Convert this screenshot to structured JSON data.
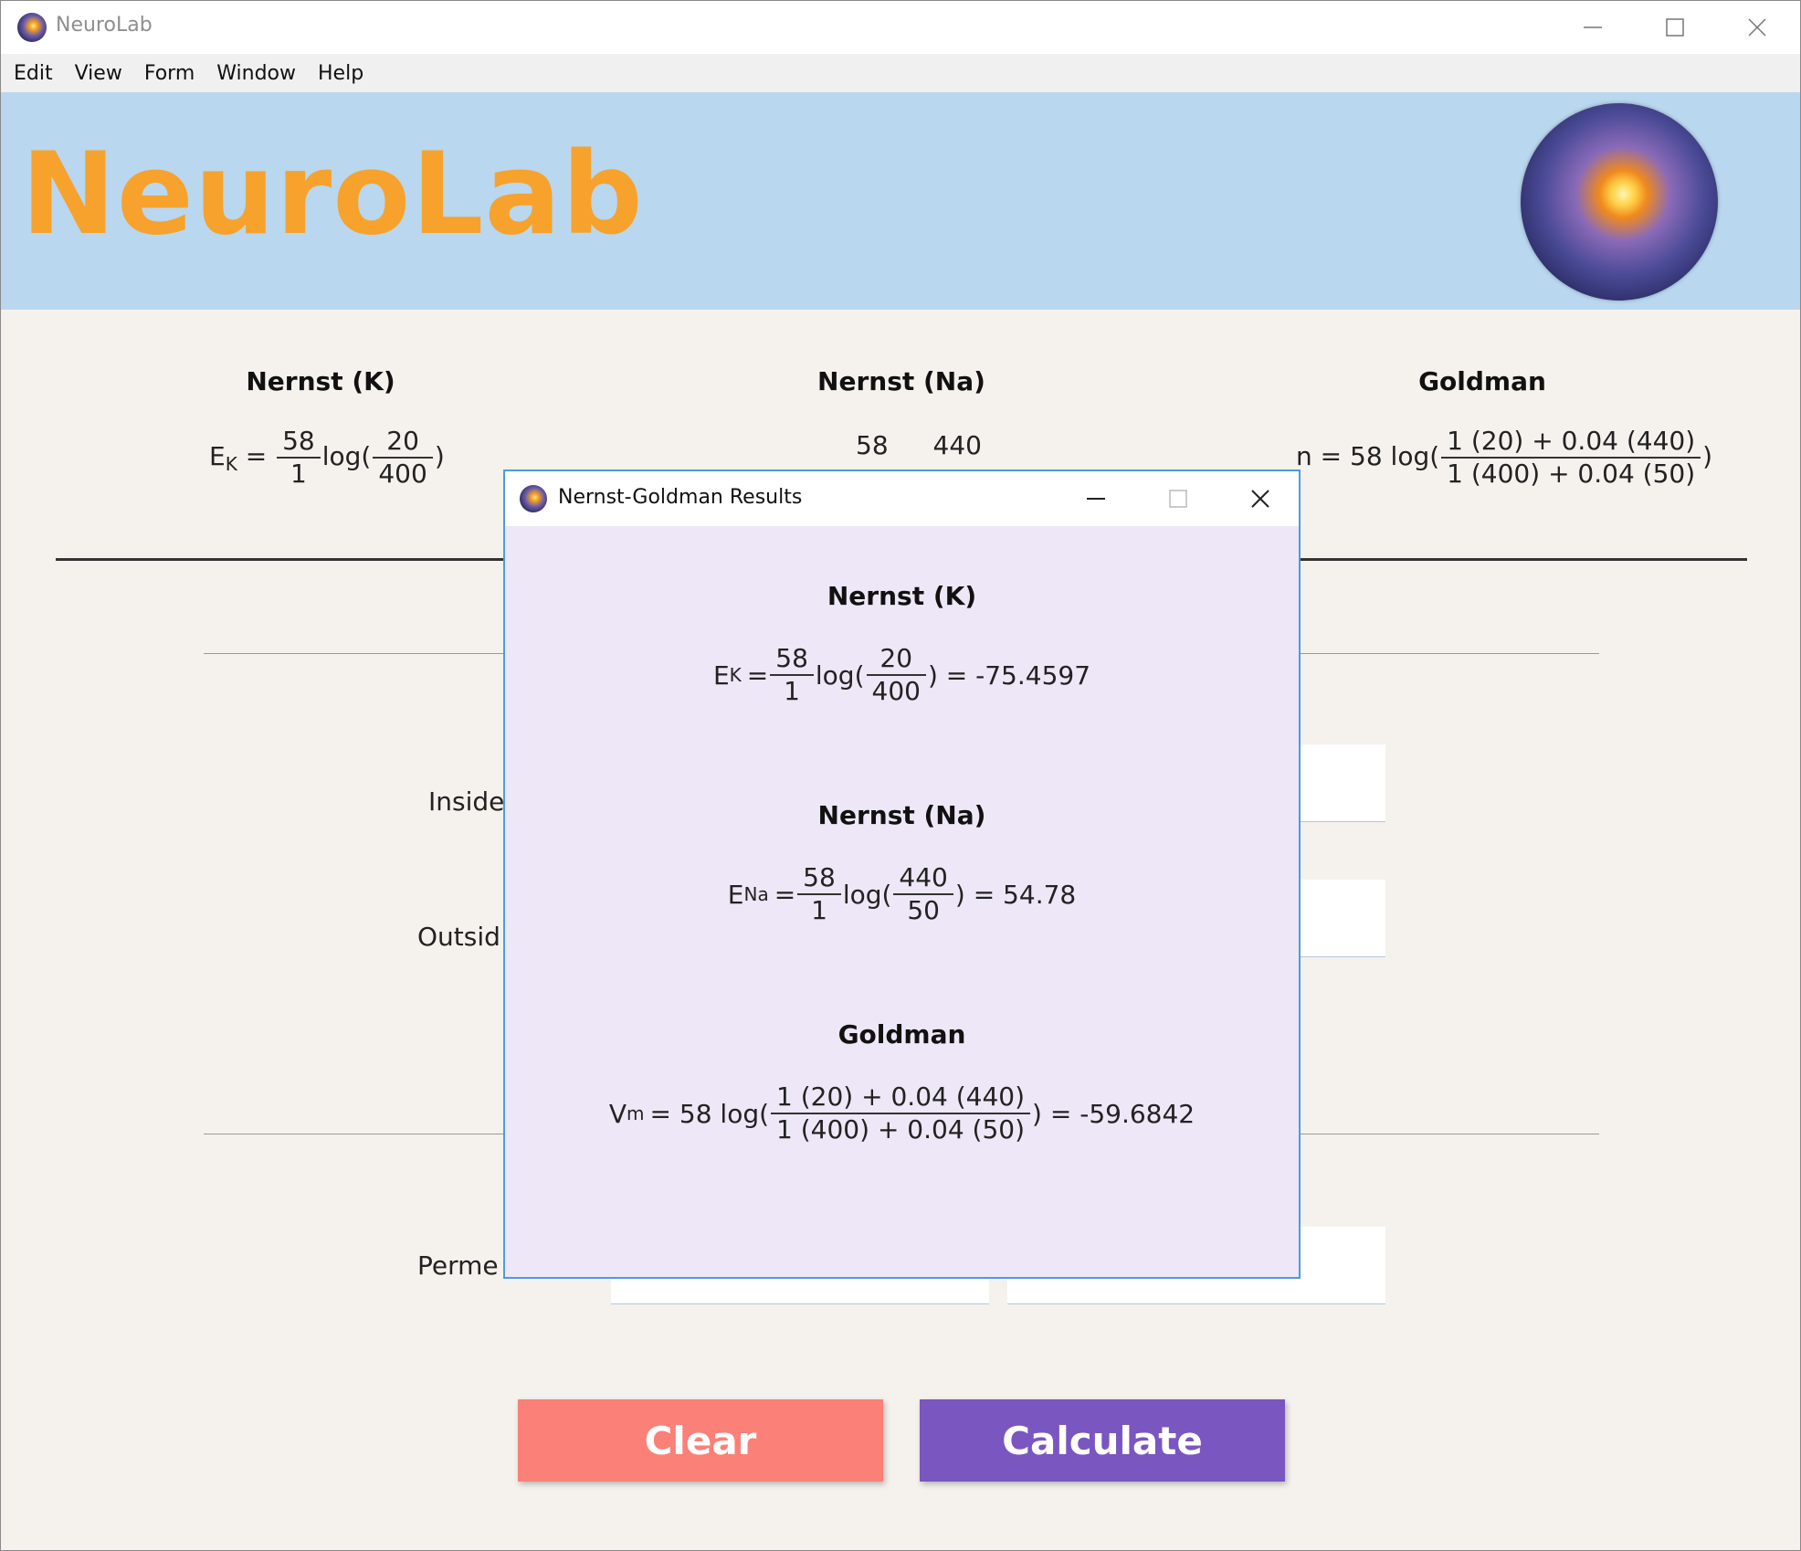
{
  "window": {
    "title": "NeuroLab",
    "min_icon": "minimize-icon",
    "max_icon": "maximize-icon",
    "close_icon": "close-icon"
  },
  "menu": [
    "Edit",
    "View",
    "Form",
    "Window",
    "Help"
  ],
  "banner": {
    "brand": "NeuroLab",
    "logo": "neuron-logo"
  },
  "main": {
    "columns": {
      "k": {
        "heading": "Nernst (K)",
        "lhs": "E",
        "lhs_sub": "K",
        "eq": "=",
        "coef_num": "58",
        "coef_den": "1",
        "log": "log(",
        "ratio_num": "20",
        "ratio_den": "400",
        "close": ")"
      },
      "na": {
        "heading": "Nernst (Na)",
        "coef_num": "58",
        "ratio_num": "440"
      },
      "goldman": {
        "heading": "Goldman",
        "lhs_visible": "n",
        "eq": "= 58 log(",
        "num": "1 (20) + 0.04 (440)",
        "den": "1 (400) + 0.04 (50)",
        "close": ")"
      }
    },
    "rows": {
      "inside": "Inside",
      "outside": "Outsid",
      "permeability": "Perme"
    },
    "buttons": {
      "clear": "Clear",
      "calculate": "Calculate"
    }
  },
  "modal": {
    "title": "Nernst-Goldman Results",
    "k": {
      "heading": "Nernst (K)",
      "lhs": "E",
      "lhs_sub": "K",
      "eq": "=",
      "coef_num": "58",
      "coef_den": "1",
      "log": "log(",
      "ratio_num": "20",
      "ratio_den": "400",
      "result": ") = -75.4597"
    },
    "na": {
      "heading": "Nernst (Na)",
      "lhs": "E",
      "lhs_sub": "Na",
      "eq": "=",
      "coef_num": "58",
      "coef_den": "1",
      "log": "log(",
      "ratio_num": "440",
      "ratio_den": "50",
      "result": ") = 54.78"
    },
    "goldman": {
      "heading": "Goldman",
      "lhs": "V",
      "lhs_sub": "m",
      "eq": "= 58 log(",
      "num": "1 (20) + 0.04 (440)",
      "den": "1 (400) + 0.04 (50)",
      "result": ") = -59.6842"
    }
  }
}
